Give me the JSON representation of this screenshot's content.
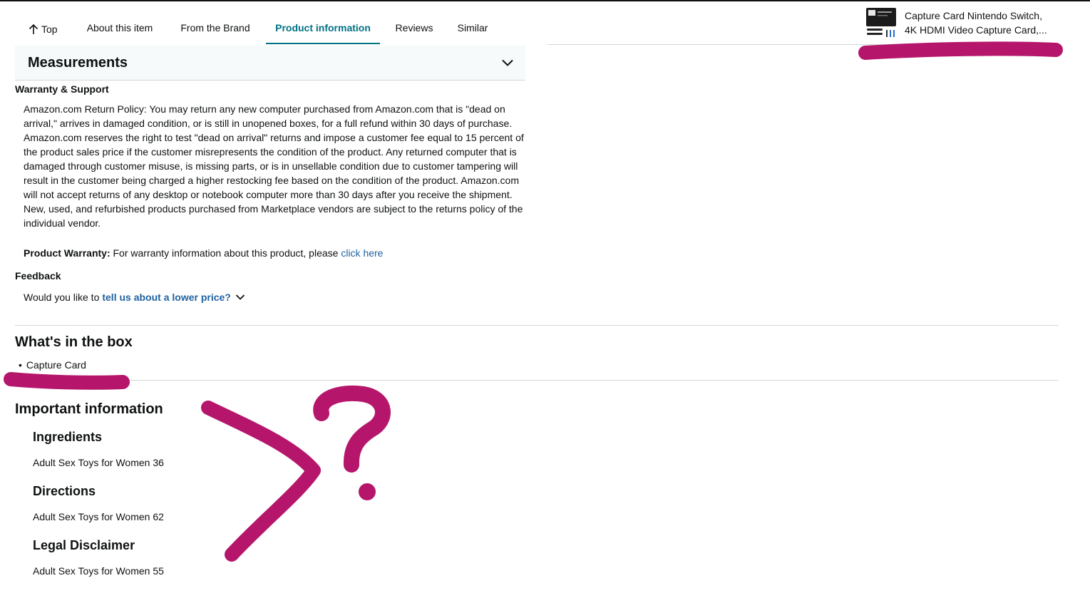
{
  "nav": {
    "top_label": "Top",
    "items": [
      "About this item",
      "From the Brand",
      "Product information",
      "Reviews",
      "Similar"
    ],
    "active_index": 2
  },
  "product": {
    "title_line1": "Capture Card Nintendo Switch,",
    "title_line2": "4K HDMI Video Capture Card,..."
  },
  "measurements": {
    "title": "Measurements"
  },
  "warranty_support": {
    "label": "Warranty & Support",
    "policy_text": "Amazon.com Return Policy: You may return any new computer purchased from Amazon.com that is \"dead on arrival,\" arrives in damaged condition, or is still in unopened boxes, for a full refund within 30 days of purchase. Amazon.com reserves the right to test \"dead on arrival\" returns and impose a customer fee equal to 15 percent of the product sales price if the customer misrepresents the condition of the product. Any returned computer that is damaged through customer misuse, is missing parts, or is in unsellable condition due to customer tampering will result in the customer being charged a higher restocking fee based on the condition of the product. Amazon.com will not accept returns of any desktop or notebook computer more than 30 days after you receive the shipment. New, used, and refurbished products purchased from Marketplace vendors are subject to the returns policy of the individual vendor.",
    "warranty_label": "Product Warranty:",
    "warranty_text": "For warranty information about this product, please",
    "warranty_link": "click here"
  },
  "feedback": {
    "label": "Feedback",
    "prompt": "Would you like to",
    "link": "tell us about a lower price?"
  },
  "in_the_box": {
    "title": "What's in the box",
    "items": [
      "Capture Card"
    ]
  },
  "important_info": {
    "title": "Important information",
    "sections": [
      {
        "heading": "Ingredients",
        "text": "Adult Sex Toys for Women 36"
      },
      {
        "heading": "Directions",
        "text": "Adult Sex Toys for Women 62"
      },
      {
        "heading": "Legal Disclaimer",
        "text": "Adult Sex Toys for Women 55"
      }
    ]
  },
  "colors": {
    "accent": "#007185",
    "link": "#2162a1",
    "annotation": "#b5166b"
  }
}
